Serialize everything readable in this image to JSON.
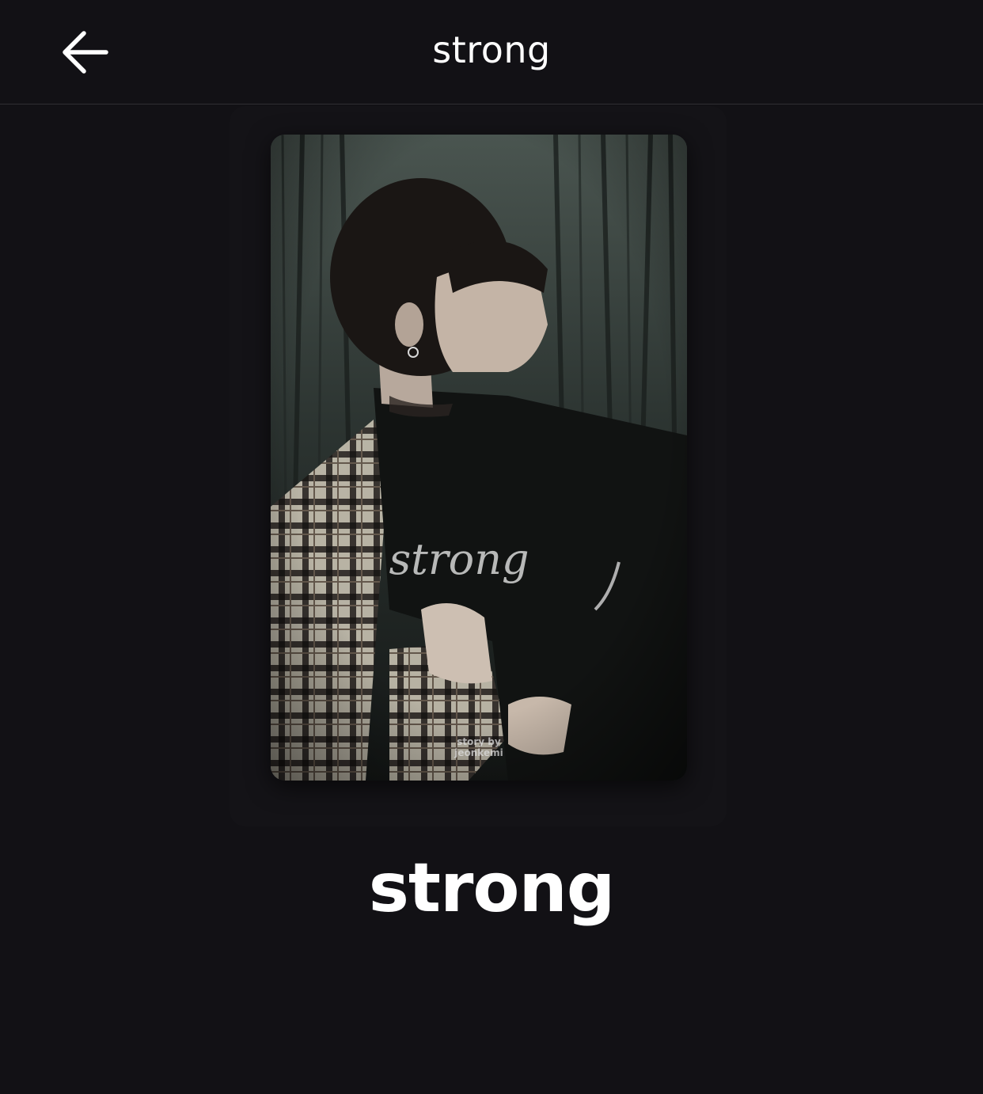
{
  "header": {
    "back_icon": "arrow-left-icon",
    "title": "strong"
  },
  "cover": {
    "art_text": "strong",
    "credit_line1": "story by",
    "credit_line2": "jeonkemi"
  },
  "story": {
    "title": "strong"
  },
  "colors": {
    "background": "#121115",
    "divider": "#2f2e33",
    "text": "#ffffff"
  }
}
